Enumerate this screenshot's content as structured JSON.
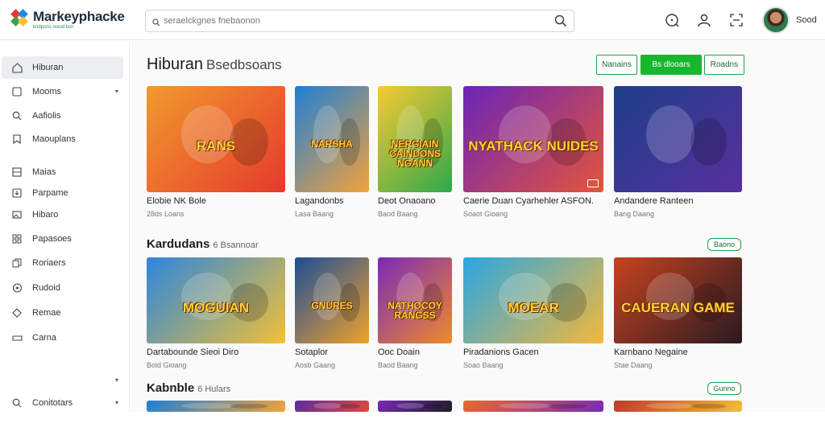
{
  "app": {
    "name": "Markeyphacke",
    "tagline": "kndpsrio nooal bsn",
    "search_placeholder": "seraelckgnes fnebaonon",
    "user_name": "Sood"
  },
  "icons": {
    "search": "search-icon",
    "help": "help-icon",
    "account": "user-icon",
    "fullscreen": "expand-icon"
  },
  "sidebar": {
    "items": [
      {
        "label": "Hiburan",
        "icon": "home-icon",
        "active": true
      },
      {
        "label": "Mooms",
        "icon": "square-icon",
        "chevron": true
      },
      {
        "label": "Aafiolis",
        "icon": "search-icon"
      },
      {
        "label": "Maouplans",
        "icon": "bookmark-icon"
      },
      {
        "label": "Maias",
        "icon": "grid-icon"
      },
      {
        "label": "Parpame",
        "icon": "download-icon"
      },
      {
        "label": "Hibaro",
        "icon": "image-icon"
      },
      {
        "label": "Papasoes",
        "icon": "apps-icon"
      },
      {
        "label": "Roriaers",
        "icon": "copy-icon"
      },
      {
        "label": "Rudoid",
        "icon": "gamepad-icon"
      },
      {
        "label": "Remae",
        "icon": "tag-icon"
      },
      {
        "label": "Carna",
        "icon": "controller-icon"
      },
      {
        "label": "",
        "icon": "",
        "chevron": true
      },
      {
        "label": "Conitotars",
        "icon": "search-icon",
        "chevron": true
      }
    ]
  },
  "header": {
    "title": "Hiburan",
    "subtitle": "Bsedbsoans",
    "filters": [
      {
        "label": "Nanains",
        "primary": false
      },
      {
        "label": "Bs dlooars",
        "primary": true
      },
      {
        "label": "Roadns",
        "primary": false
      }
    ]
  },
  "sections": [
    {
      "title": "Kardudans",
      "subtitle": "6 Bsannoar",
      "pill": "Baono"
    },
    {
      "title": "Kabnble",
      "subtitle": "6 Hulars",
      "pill": "Gunno"
    }
  ],
  "row1": [
    {
      "name": "Elobie NK Bole",
      "meta": "28ds Loans",
      "art_text": "RANS",
      "colors": [
        "#f29a2e",
        "#e43a2b"
      ]
    },
    {
      "name": "Lagandonbs",
      "meta": "Lasa Baang",
      "art_text": "NARSHA",
      "colors": [
        "#1e7fd6",
        "#f4a23b"
      ]
    },
    {
      "name": "Deot Onaoano",
      "meta": "Baod Baang",
      "art_text": "NERGIAIN CAINDONS NGANN",
      "colors": [
        "#f9c933",
        "#2ea84a"
      ]
    },
    {
      "name": "Caerie Duan Cyarhehler ASFON.",
      "meta": "Soaot Gioang",
      "art_text": "NYATHACK NUIDES",
      "colors": [
        "#6a24b8",
        "#e4553a"
      ]
    },
    {
      "name": "Andandere Ranteen",
      "meta": "Bang Daang",
      "art_text": "",
      "colors": [
        "#1e3f8a",
        "#58309e"
      ]
    }
  ],
  "row2": [
    {
      "name": "Dartabounde Sieoi Diro",
      "meta": "Boid Gioang",
      "art_text": "MOGUIAN",
      "colors": [
        "#2c86dd",
        "#f2c037"
      ]
    },
    {
      "name": "Sotaplor",
      "meta": "Aosb Gaang",
      "art_text": "GNURES",
      "colors": [
        "#1d4d97",
        "#f1a22a"
      ]
    },
    {
      "name": "Ooc Doain",
      "meta": "Baod Baang",
      "art_text": "NATHOCOY RANGSS",
      "colors": [
        "#7a2ab8",
        "#ef8a2a"
      ]
    },
    {
      "name": "Piradanions Gacen",
      "meta": "Soao Baang",
      "art_text": "MOEAR",
      "colors": [
        "#2aa6e4",
        "#f4b83a"
      ]
    },
    {
      "name": "Karnbano Negaine",
      "meta": "Stae Daang",
      "art_text": "CAUERAN GAME",
      "colors": [
        "#c6431e",
        "#2a1a22"
      ]
    }
  ],
  "row3": [
    {
      "colors": [
        "#1e7fd6",
        "#f4a23b"
      ]
    },
    {
      "colors": [
        "#5a2aa0",
        "#e24a3a"
      ]
    },
    {
      "colors": [
        "#7a2ab8",
        "#1e1e2a"
      ]
    },
    {
      "colors": [
        "#e86a2a",
        "#7a2ab8"
      ]
    },
    {
      "colors": [
        "#c0392b",
        "#f2c037"
      ]
    }
  ]
}
